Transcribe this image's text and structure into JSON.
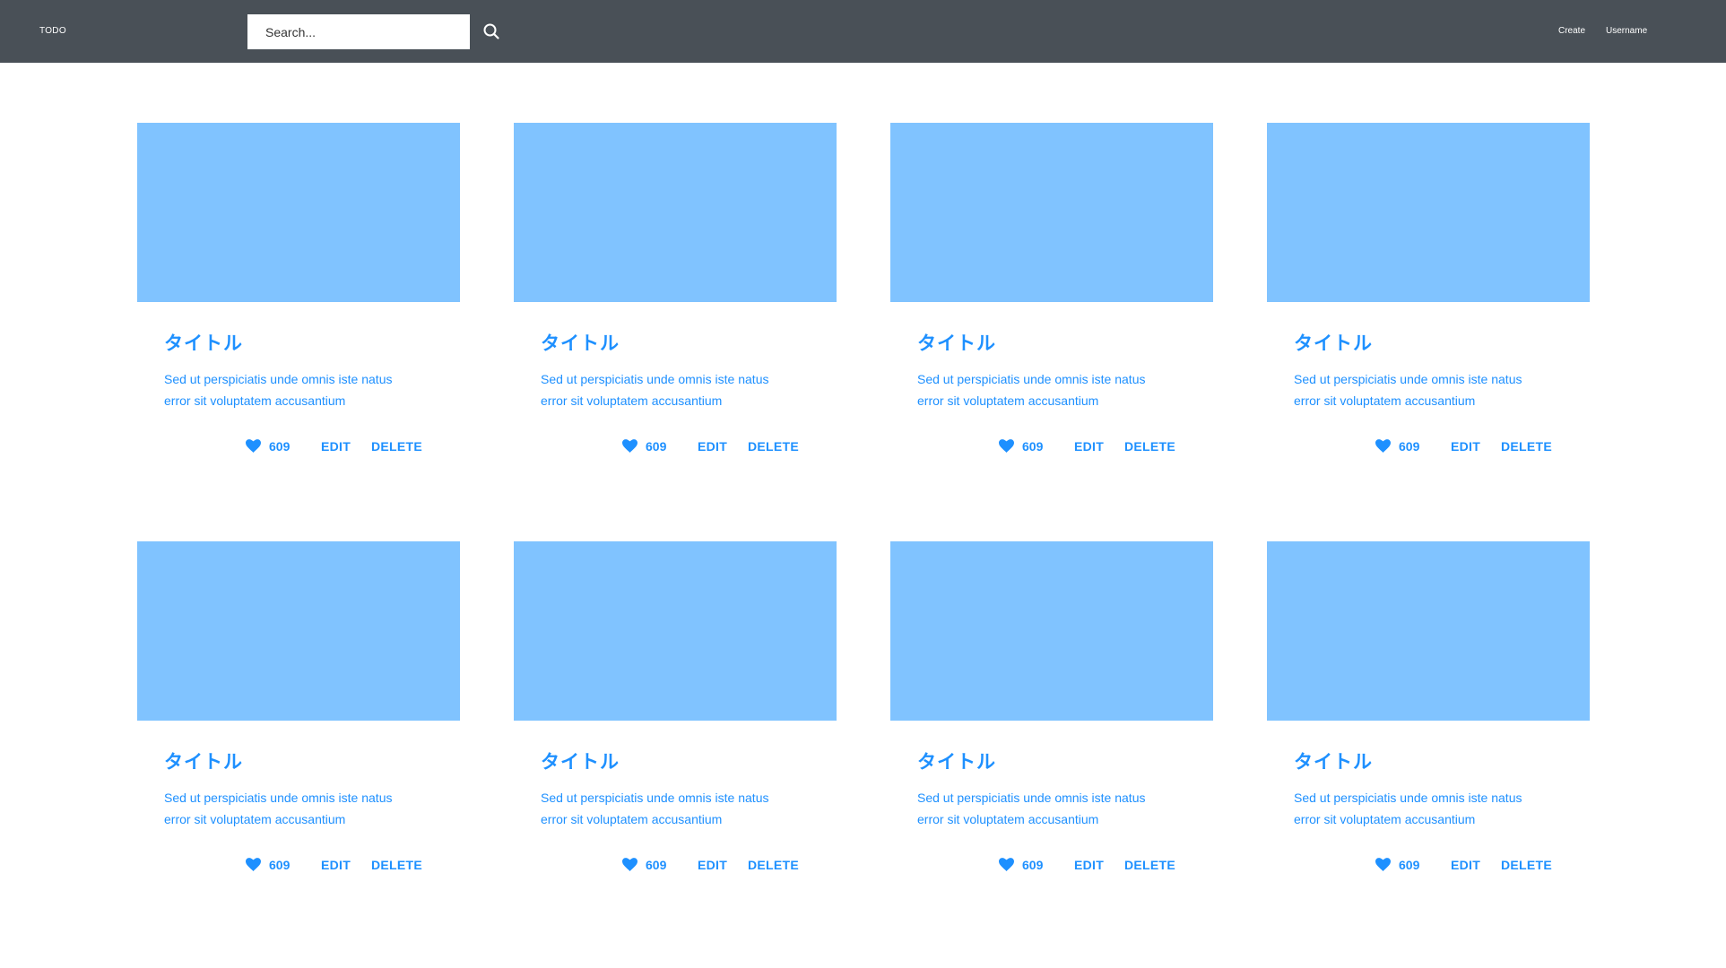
{
  "header": {
    "brand": "TODO",
    "search_placeholder": "Search...",
    "nav": {
      "create": "Create",
      "username": "Username"
    }
  },
  "colors": {
    "header_bg": "#495057",
    "accent": "#1e90ff",
    "card_image": "#80c3ff"
  },
  "cards": [
    {
      "title": "タイトル",
      "desc_line1": "Sed ut perspiciatis unde omnis iste natus",
      "desc_line2": "error sit voluptatem accusantium",
      "likes": "609",
      "edit": "EDIT",
      "delete": "DELETE"
    },
    {
      "title": "タイトル",
      "desc_line1": "Sed ut perspiciatis unde omnis iste natus",
      "desc_line2": "error sit voluptatem accusantium",
      "likes": "609",
      "edit": "EDIT",
      "delete": "DELETE"
    },
    {
      "title": "タイトル",
      "desc_line1": "Sed ut perspiciatis unde omnis iste natus",
      "desc_line2": "error sit voluptatem accusantium",
      "likes": "609",
      "edit": "EDIT",
      "delete": "DELETE"
    },
    {
      "title": "タイトル",
      "desc_line1": "Sed ut perspiciatis unde omnis iste natus",
      "desc_line2": "error sit voluptatem accusantium",
      "likes": "609",
      "edit": "EDIT",
      "delete": "DELETE"
    },
    {
      "title": "タイトル",
      "desc_line1": "Sed ut perspiciatis unde omnis iste natus",
      "desc_line2": "error sit voluptatem accusantium",
      "likes": "609",
      "edit": "EDIT",
      "delete": "DELETE"
    },
    {
      "title": "タイトル",
      "desc_line1": "Sed ut perspiciatis unde omnis iste natus",
      "desc_line2": "error sit voluptatem accusantium",
      "likes": "609",
      "edit": "EDIT",
      "delete": "DELETE"
    },
    {
      "title": "タイトル",
      "desc_line1": "Sed ut perspiciatis unde omnis iste natus",
      "desc_line2": "error sit voluptatem accusantium",
      "likes": "609",
      "edit": "EDIT",
      "delete": "DELETE"
    },
    {
      "title": "タイトル",
      "desc_line1": "Sed ut perspiciatis unde omnis iste natus",
      "desc_line2": "error sit voluptatem accusantium",
      "likes": "609",
      "edit": "EDIT",
      "delete": "DELETE"
    }
  ]
}
